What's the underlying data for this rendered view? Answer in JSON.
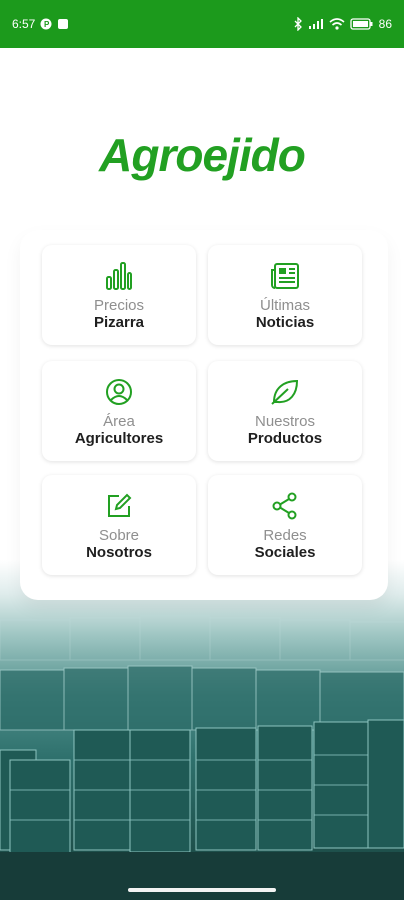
{
  "status_bar": {
    "time": "6:57",
    "battery": "86",
    "icons": [
      "p-icon",
      "square-icon",
      "bluetooth-icon",
      "signal-icon",
      "wifi-icon",
      "battery-icon"
    ]
  },
  "brand": {
    "logo": "Agroejido",
    "color": "#22a022"
  },
  "menu": [
    {
      "light": "Precios",
      "bold": "Pizarra",
      "icon": "bar-chart-icon"
    },
    {
      "light": "Últimas",
      "bold": "Noticias",
      "icon": "newspaper-icon"
    },
    {
      "light": "Área",
      "bold": "Agricultores",
      "icon": "user-circle-icon"
    },
    {
      "light": "Nuestros",
      "bold": "Productos",
      "icon": "leaf-icon"
    },
    {
      "light": "Sobre",
      "bold": "Nosotros",
      "icon": "edit-icon"
    },
    {
      "light": "Redes",
      "bold": "Sociales",
      "icon": "share-icon"
    }
  ],
  "colors": {
    "status_bar": "#1c9a1c",
    "accent": "#22a022",
    "background_tint": "#2f716d"
  }
}
